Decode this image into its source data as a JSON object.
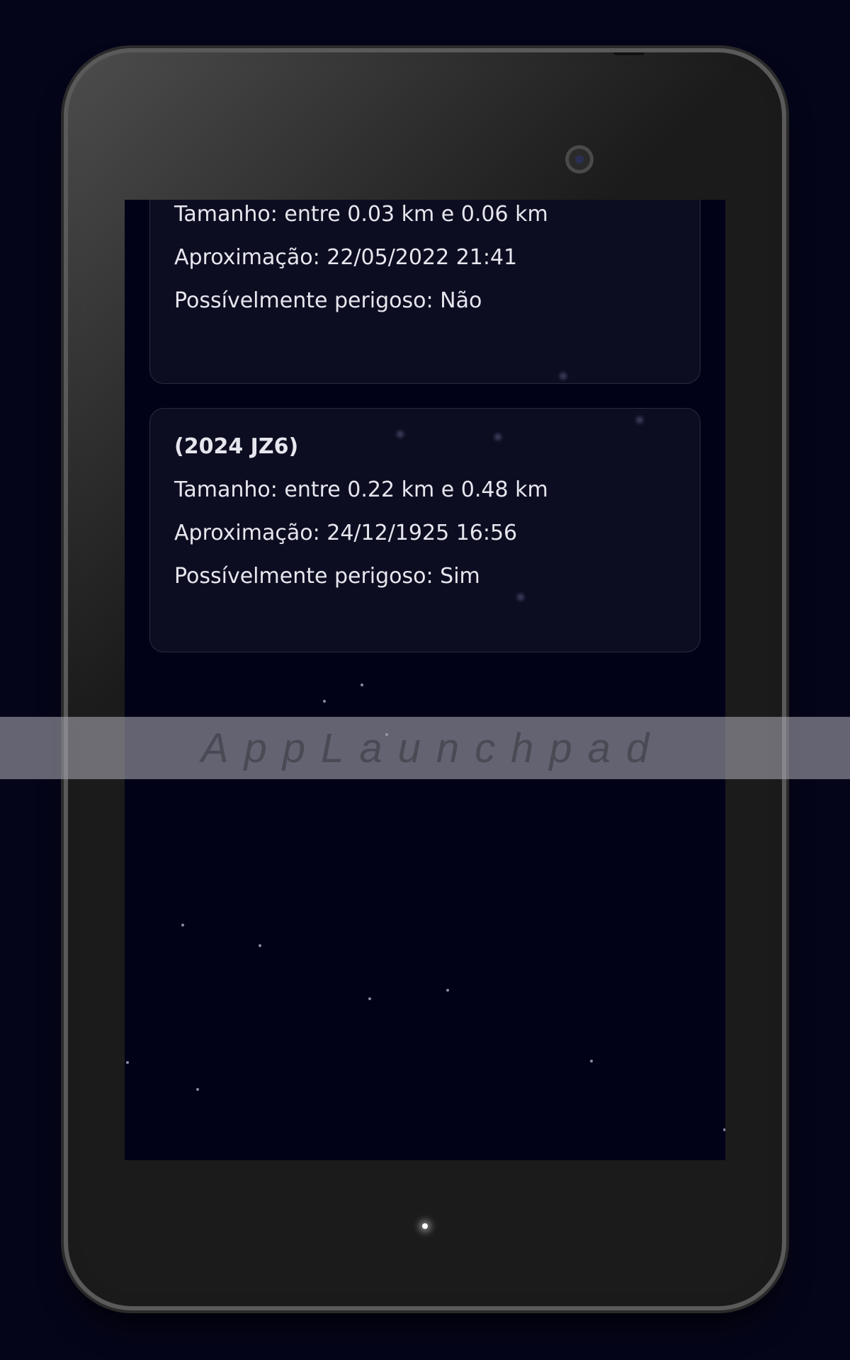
{
  "asteroids": [
    {
      "size": "Tamanho: entre 0.03 km e 0.06 km",
      "approach": "Aproximação: 22/05/2022 21:41",
      "hazardous": "Possívelmente perigoso: Não"
    },
    {
      "name": "(2024 JZ6)",
      "size": "Tamanho: entre 0.22 km e 0.48 km",
      "approach": "Aproximação: 24/12/1925 16:56",
      "hazardous": "Possívelmente perigoso: Sim"
    }
  ],
  "watermark": "AppLaunchpad",
  "colors": {
    "background": "#05051a",
    "screen": "#010118",
    "card": "#0d0d22",
    "text": "#e6e6ee",
    "device_frame": "#1a1a1a"
  }
}
